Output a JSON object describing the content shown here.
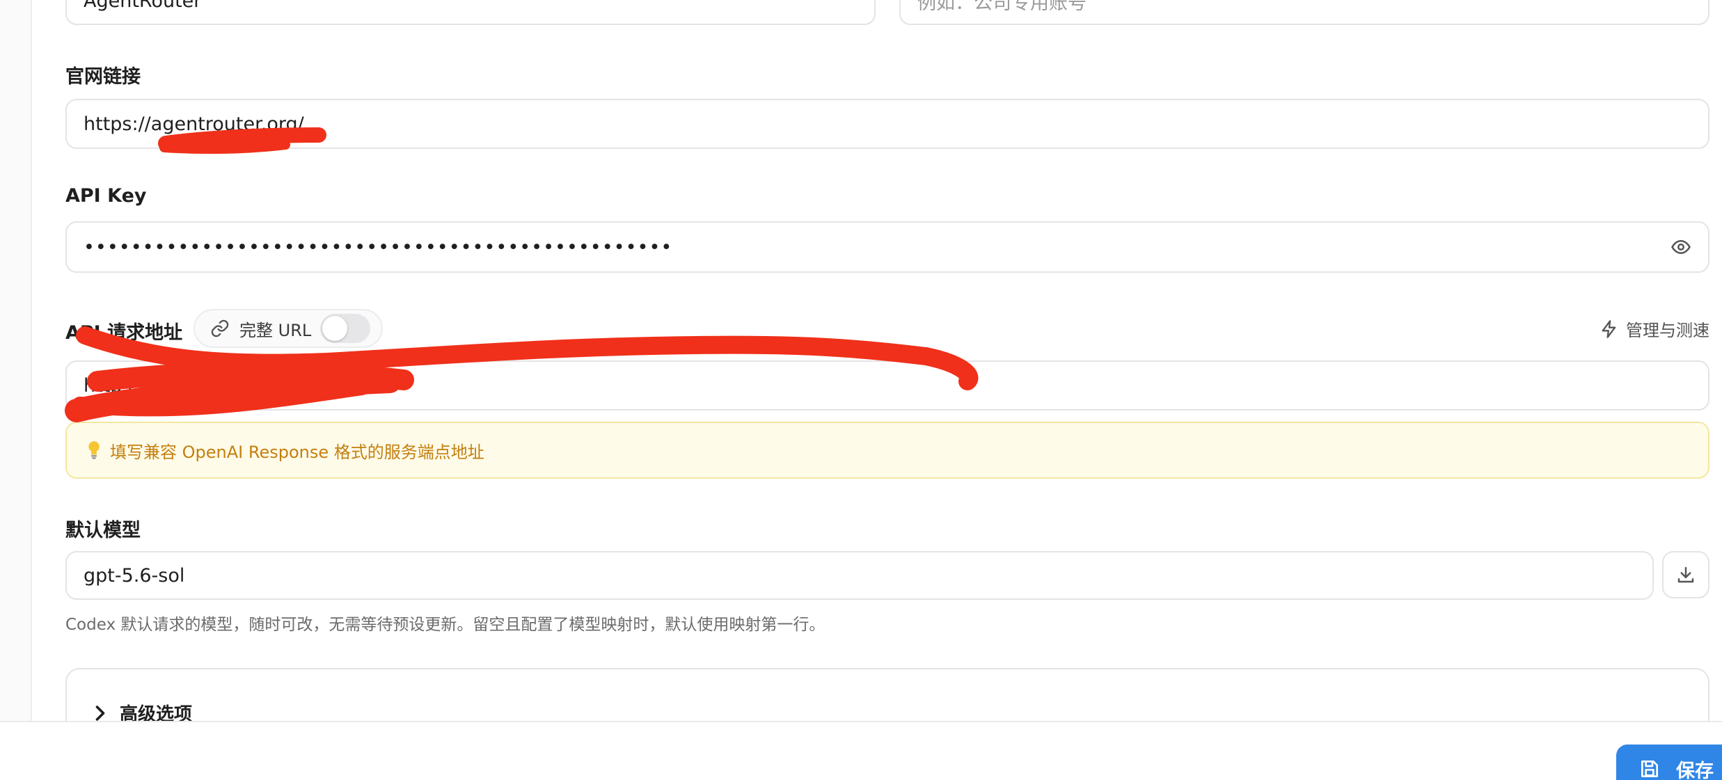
{
  "form": {
    "name_field_value": "AgentRouter",
    "remark_field_placeholder": "例如：公司专用账号",
    "website": {
      "label": "官网链接",
      "value": "https://agentrouter.org/"
    },
    "api_key": {
      "label": "API Key",
      "masked_value": "••••••••••••••••••••••••••••••••••••••••••••••••••",
      "reveal_icon": "eye-icon"
    },
    "api_endpoint": {
      "label": "API 请求地址",
      "full_url_toggle_label": "完整 URL",
      "full_url_toggle_on": false,
      "manage_label": "管理与测速",
      "value": "https://agentrouter.org/v1",
      "hint": "填写兼容 OpenAI Response 格式的服务端点地址"
    },
    "default_model": {
      "label": "默认模型",
      "value": "gpt-5.6-sol",
      "fetch_icon": "download-icon",
      "helper": "Codex 默认请求的模型，随时可改，无需等待预设更新。留空且配置了模型映射时，默认使用映射第一行。"
    },
    "advanced": {
      "label": "高级选项",
      "expanded": false
    }
  },
  "footer": {
    "save_label": "保存"
  },
  "colors": {
    "accent": "#2f86e6",
    "hint_text": "#c47f10",
    "hint_bg": "#fefbe8",
    "redaction": "#f0301a"
  }
}
